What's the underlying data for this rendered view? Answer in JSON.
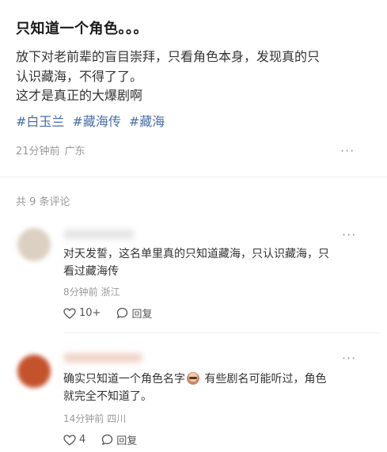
{
  "post": {
    "title": "只知道一个角色。。。",
    "body_lines": [
      "放下对老前辈的盲目崇拜，只看角色本身，发现真的只",
      "认识藏海，不得了了。",
      "这才是真正的大爆剧啊"
    ],
    "tags": [
      "#白玉兰",
      "#藏海传",
      "#藏海"
    ],
    "time": "21分钟前",
    "location": "广东",
    "more": "···"
  },
  "comments_count": "共 9 条评论",
  "comments": [
    {
      "lines": [
        "对天发誓，这名单里真的只知道藏海，只认识藏海，只",
        "看过藏海传"
      ],
      "time": "8分钟前",
      "location": "浙江",
      "likes": "10+",
      "reply_label": "回复",
      "more": "···",
      "avatar_color": "#d8cbbb"
    },
    {
      "text_before_emoji": "确实只知道一个角色名字",
      "text_after_emoji": " 有些剧名可能听过，角色",
      "line2": "就完全不知道了。",
      "time": "14分钟前",
      "location": "四川",
      "likes": "4",
      "reply_label": "回复",
      "more": "···",
      "avatar_color": "#c4532c"
    }
  ]
}
